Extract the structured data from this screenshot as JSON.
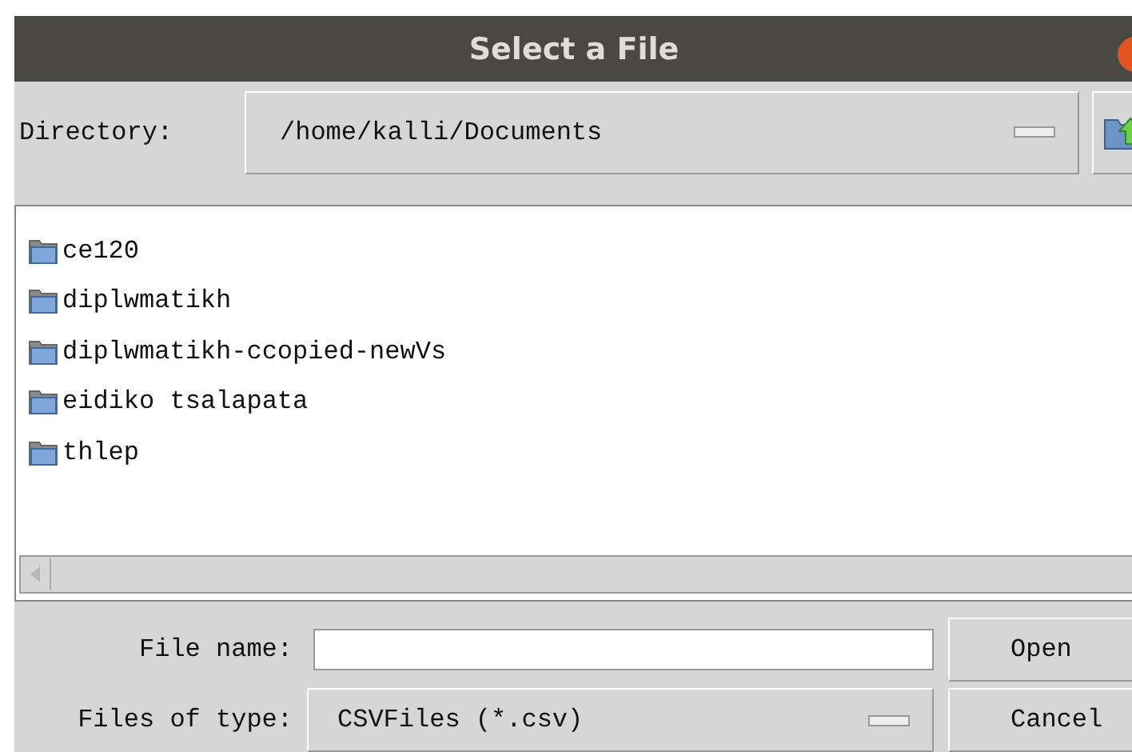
{
  "window": {
    "title": "Select a File"
  },
  "directory": {
    "label": "Directory:",
    "value": "/home/kalli/Documents"
  },
  "files": [
    {
      "name": "ce120",
      "kind": "folder"
    },
    {
      "name": "diplwmatikh",
      "kind": "folder"
    },
    {
      "name": "diplwmatikh-ccopied-newVs",
      "kind": "folder"
    },
    {
      "name": "eidiko tsalapata",
      "kind": "folder"
    },
    {
      "name": "thlep",
      "kind": "folder"
    }
  ],
  "file_name": {
    "label": "File name:"
  },
  "file_type": {
    "label": "Files of type:",
    "value": "CSVFiles (*.csv)"
  },
  "buttons": [
    "Open",
    "Cancel"
  ]
}
